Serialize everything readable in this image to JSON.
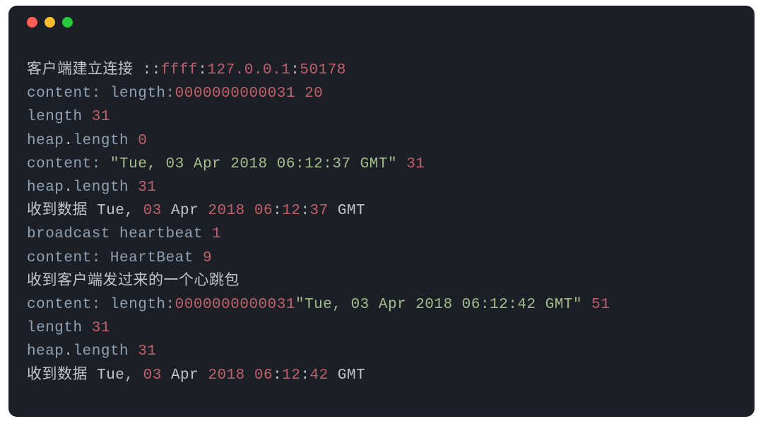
{
  "window": {
    "kind": "terminal"
  },
  "lines": {
    "l1": {
      "cn": "客户端建立连接 ",
      "colon2": "::",
      "ffff": "ffff",
      "sep1": ":",
      "ip": "127.0.0.1",
      "sep2": ":",
      "port": "50178"
    },
    "l2": {
      "label": "content: length:",
      "hex": "0000000000031",
      "space": " ",
      "num": "20"
    },
    "l3": {
      "label": "length ",
      "num": "31"
    },
    "l4": {
      "heap": "heap",
      "dot": ".",
      "length": "length ",
      "num": "0"
    },
    "l5": {
      "label": "content: ",
      "str": "\"Tue, 03 Apr 2018 06:12:37 GMT\"",
      "space": " ",
      "num": "31"
    },
    "l6": {
      "heap": "heap",
      "dot": ".",
      "length": "length ",
      "num": "31"
    },
    "l7": {
      "cn": "收到数据 Tue, ",
      "n1": "03",
      "t1": " Apr ",
      "n2": "2018",
      "t2": " ",
      "n3": "06",
      "t3": ":",
      "n4": "12",
      "t4": ":",
      "n5": "37",
      "t5": " GMT"
    },
    "l8": {
      "label": "broadcast heartbeat ",
      "num": "1"
    },
    "l9": {
      "label": "content: HeartBeat ",
      "num": "9"
    },
    "l10": {
      "cn": "收到客户端发过来的一个心跳包"
    },
    "l11": {
      "label": "content: length:",
      "hex": "0000000000031",
      "str": "\"Tue, 03 Apr 2018 06:12:42 GMT\"",
      "space": " ",
      "num": "51"
    },
    "l12": {
      "label": "length ",
      "num": "31"
    },
    "l13": {
      "heap": "heap",
      "dot": ".",
      "length": "length ",
      "num": "31"
    },
    "l14": {
      "cn": "收到数据 Tue, ",
      "n1": "03",
      "t1": " Apr ",
      "n2": "2018",
      "t2": " ",
      "n3": "06",
      "t3": ":",
      "n4": "12",
      "t4": ":",
      "n5": "42",
      "t5": " GMT"
    }
  }
}
